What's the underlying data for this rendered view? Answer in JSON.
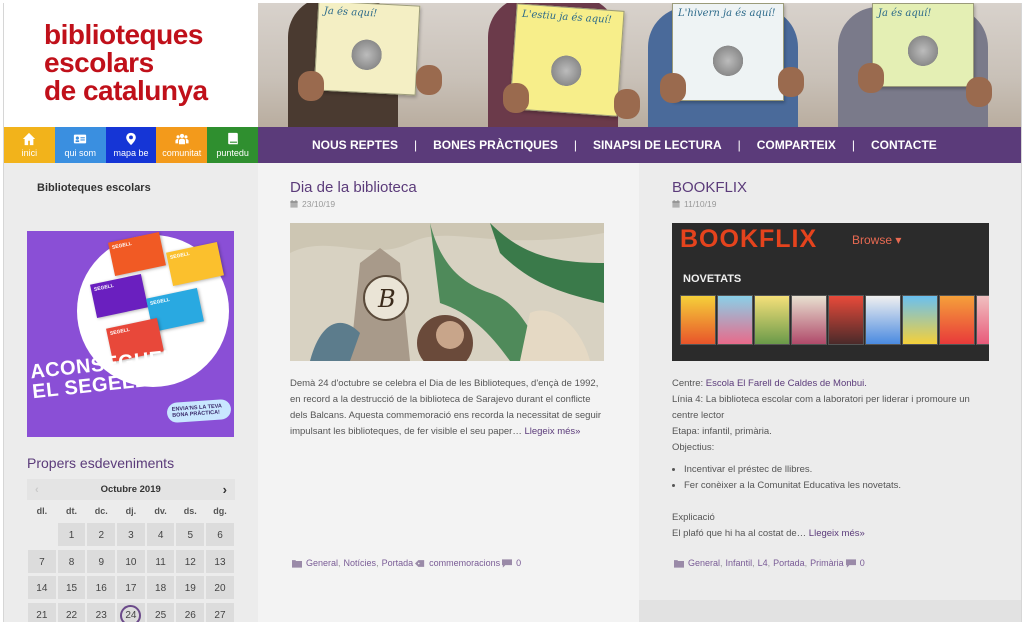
{
  "logo": {
    "lines": [
      "biblioteques",
      "escolars",
      "de catalunya"
    ],
    "color": "#c0101a"
  },
  "hero": {
    "book_titles": [
      "Ja és aquí!",
      "L'estiu ja és aquí!",
      "L'hivern ja és aquí!",
      "Ja és aquí!"
    ]
  },
  "icon_nav": [
    {
      "label": "inici",
      "icon": "home-icon",
      "color": "#f2b31b"
    },
    {
      "label": "qui som",
      "icon": "id-card-icon",
      "color": "#3a8fe0"
    },
    {
      "label": "mapa be",
      "icon": "map-pin-icon",
      "color": "#1535d6"
    },
    {
      "label": "comunitat",
      "icon": "people-icon",
      "color": "#f39a1b"
    },
    {
      "label": "puntedu",
      "icon": "book-icon",
      "color": "#2f8f2f"
    }
  ],
  "main_nav": [
    "NOUS REPTES",
    "BONES PRÀCTIQUES",
    "SINAPSI DE LECTURA",
    "COMPARTEIX",
    "CONTACTE"
  ],
  "sidebar": {
    "title": "Biblioteques escolars",
    "promo": {
      "big_text": "ACONSEGUEIX EL SEGELL!",
      "small_text": "ENVIA'NS LA TEVA BONA PRÀCTICA!",
      "card_label": "SEGELL"
    },
    "events_title": "Propers esdeveniments",
    "calendar": {
      "month": "Octubre 2019",
      "prev": "‹",
      "next": "›",
      "weekdays": [
        "dl.",
        "dt.",
        "dc.",
        "dj.",
        "dv.",
        "ds.",
        "dg."
      ],
      "weeks": [
        [
          "",
          "1",
          "2",
          "3",
          "4",
          "5",
          "6"
        ],
        [
          "7",
          "8",
          "9",
          "10",
          "11",
          "12",
          "13"
        ],
        [
          "14",
          "15",
          "16",
          "17",
          "18",
          "19",
          "20"
        ],
        [
          "21",
          "22",
          "23",
          "24",
          "25",
          "26",
          "27"
        ]
      ],
      "today": "24"
    }
  },
  "posts": [
    {
      "title": "Dia de la biblioteca",
      "date": "23/10/19",
      "excerpt": "Demà 24 d'octubre se celebra el Dia de les Biblioteques, d'ençà de 1992, en record a la destrucció de la biblioteca de Sarajevo durant el conflicte dels Balcans. Aquesta commemoració ens recorda la necessitat de seguir impulsant les biblioteques, de fer visible el seu paper…",
      "read_more": "Llegeix més»",
      "categories": [
        "General",
        "Notícies",
        "Portada"
      ],
      "tags": [
        "commemoracions"
      ],
      "comments": "0"
    },
    {
      "title": "BOOKFLIX",
      "date": "11/10/19",
      "image": {
        "logo": "BOOKFLIX",
        "browse": "Browse ▾",
        "section": "NOVETATS"
      },
      "centre_label": "Centre:",
      "centre_value": "Escola El Farell de Caldes de Monbui.",
      "line4": "Línia 4: La biblioteca escolar com a laboratori per liderar i promoure un centre lector",
      "etapa": "Etapa: infantil, primària.",
      "objectius_label": "Objectius:",
      "objectius": [
        "Incentivar el préstec de llibres.",
        "Fer conèixer a la Comunitat Educativa les novetats."
      ],
      "explicacio_label": "Explicació",
      "explicacio_text": "El plafó que hi ha al costat de…",
      "read_more": "Llegeix més»",
      "categories": [
        "General",
        "Infantil",
        "L4",
        "Portada",
        "Primària"
      ],
      "comments": "0"
    }
  ],
  "colors": {
    "nav": "#5b3b7a",
    "accent": "#7a5c96"
  }
}
